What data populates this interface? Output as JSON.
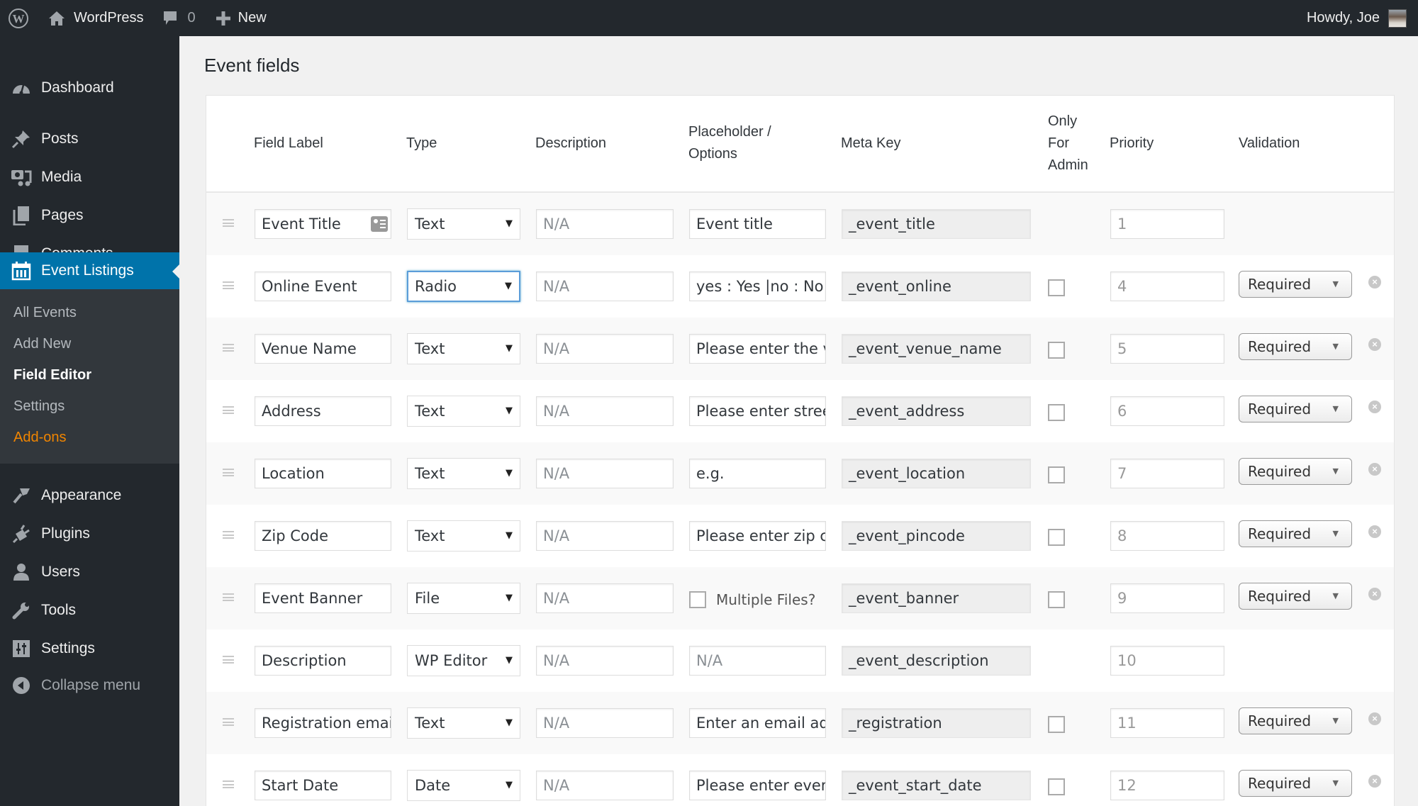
{
  "adminbar": {
    "site_name": "WordPress",
    "comments_count": "0",
    "new_label": "New",
    "howdy": "Howdy, Joe"
  },
  "sidebar": {
    "items": [
      {
        "label": "Dashboard",
        "icon": "dashboard-icon"
      },
      {
        "label": "Posts",
        "icon": "pin-icon"
      },
      {
        "label": "Media",
        "icon": "media-icon"
      },
      {
        "label": "Pages",
        "icon": "pages-icon"
      },
      {
        "label": "Comments",
        "icon": "comment-icon"
      },
      {
        "label": "Event Listings",
        "icon": "calendar-icon",
        "active": true
      },
      {
        "label": "Appearance",
        "icon": "paintbrush-icon"
      },
      {
        "label": "Plugins",
        "icon": "plugin-icon"
      },
      {
        "label": "Users",
        "icon": "user-icon"
      },
      {
        "label": "Tools",
        "icon": "wrench-icon"
      },
      {
        "label": "Settings",
        "icon": "settings-icon"
      }
    ],
    "submenu": [
      {
        "label": "All Events"
      },
      {
        "label": "Add New"
      },
      {
        "label": "Field Editor",
        "current": true
      },
      {
        "label": "Settings"
      },
      {
        "label": "Add-ons",
        "highlight": "#f18500"
      }
    ],
    "collapse_label": "Collapse menu"
  },
  "page": {
    "title": "Event fields"
  },
  "table": {
    "headers": {
      "label": "Field Label",
      "type": "Type",
      "description": "Description",
      "placeholder_1": "Placeholder /",
      "placeholder_2": "Options",
      "meta_key": "Meta Key",
      "admin_1": "Only",
      "admin_2": "For",
      "admin_3": "Admin",
      "priority": "Priority",
      "validation": "Validation"
    },
    "rows": [
      {
        "label": "Event Title",
        "type": "Text",
        "description": "N/A",
        "placeholder": "Event title",
        "meta_key": "_event_title",
        "priority": "1",
        "validation": ""
      },
      {
        "label": "Online Event",
        "type": "Radio",
        "description": "N/A",
        "placeholder": "yes : Yes |no : No",
        "meta_key": "_event_online",
        "priority": "4",
        "validation": "Required"
      },
      {
        "label": "Venue Name",
        "type": "Text",
        "description": "N/A",
        "placeholder": "Please enter the venue",
        "meta_key": "_event_venue_name",
        "priority": "5",
        "validation": "Required"
      },
      {
        "label": "Address",
        "type": "Text",
        "description": "N/A",
        "placeholder": "Please enter street",
        "meta_key": "_event_address",
        "priority": "6",
        "validation": "Required"
      },
      {
        "label": "Location",
        "type": "Text",
        "description": "N/A",
        "placeholder": "e.g.",
        "meta_key": "_event_location",
        "priority": "7",
        "validation": "Required"
      },
      {
        "label": "Zip Code",
        "type": "Text",
        "description": "N/A",
        "placeholder": "Please enter zip code",
        "meta_key": "_event_pincode",
        "priority": "8",
        "validation": "Required"
      },
      {
        "label": "Event Banner",
        "type": "File",
        "description": "N/A",
        "multiple_files_label": "Multiple Files?",
        "meta_key": "_event_banner",
        "priority": "9",
        "validation": "Required"
      },
      {
        "label": "Description",
        "type": "WP Editor",
        "description": "N/A",
        "placeholder": "N/A",
        "meta_key": "_event_description",
        "priority": "10",
        "validation": ""
      },
      {
        "label": "Registration email",
        "type": "Text",
        "description": "N/A",
        "placeholder": "Enter an email address",
        "meta_key": "_registration",
        "priority": "11",
        "validation": "Required"
      },
      {
        "label": "Start Date",
        "type": "Date",
        "description": "N/A",
        "placeholder": "Please enter event",
        "meta_key": "_event_start_date",
        "priority": "12",
        "validation": "Required"
      }
    ]
  },
  "colors": {
    "adminbar_bg": "#23282d",
    "active_menu": "#0073aa",
    "addons": "#f18500"
  }
}
